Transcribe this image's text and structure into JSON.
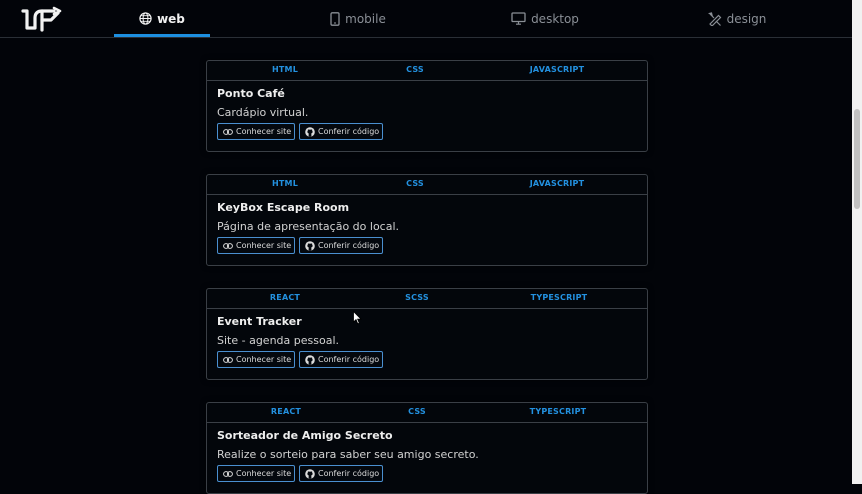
{
  "nav": {
    "logo": "logo-icon",
    "tabs": [
      {
        "label": "web",
        "icon": "globe-icon",
        "active": true
      },
      {
        "label": "mobile",
        "icon": "phone-icon",
        "active": false
      },
      {
        "label": "desktop",
        "icon": "monitor-icon",
        "active": false
      },
      {
        "label": "design",
        "icon": "pen-ruler-icon",
        "active": false
      }
    ]
  },
  "projects": [
    {
      "techs": [
        "HTML",
        "CSS",
        "JAVASCRIPT"
      ],
      "title": "Ponto Café",
      "description": "Cardápio virtual.",
      "site_label": "Conhecer site",
      "code_label": "Conferir código"
    },
    {
      "techs": [
        "HTML",
        "CSS",
        "JAVASCRIPT"
      ],
      "title": "KeyBox Escape Room",
      "description": "Página de apresentação do local.",
      "site_label": "Conhecer site",
      "code_label": "Conferir código"
    },
    {
      "techs": [
        "REACT",
        "SCSS",
        "TYPESCRIPT"
      ],
      "title": "Event Tracker",
      "description": "Site - agenda pessoal.",
      "site_label": "Conhecer site",
      "code_label": "Conferir código"
    },
    {
      "techs": [
        "REACT",
        "CSS",
        "TYPESCRIPT"
      ],
      "title": "Sorteador de Amigo Secreto",
      "description": "Realize o sorteio para saber seu amigo secreto.",
      "site_label": "Conhecer site",
      "code_label": "Conferir código"
    }
  ],
  "colors": {
    "accent": "#1d8fe0",
    "tech_label": "#2391e0",
    "background": "#020409",
    "button_border": "#4a8fd0"
  }
}
